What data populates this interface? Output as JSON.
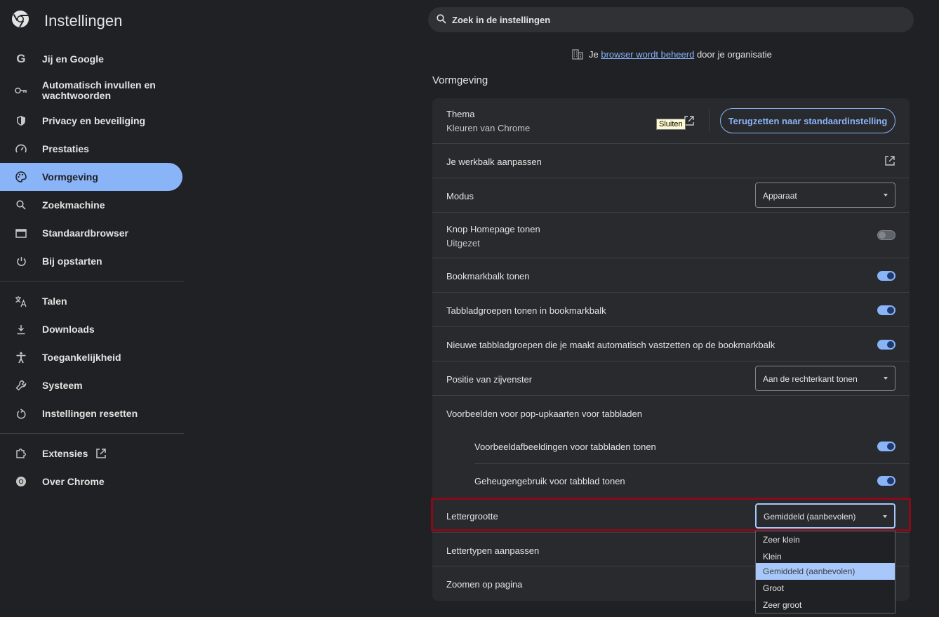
{
  "app": {
    "title": "Instellingen"
  },
  "sidebar": {
    "items": [
      {
        "label": "Jij en Google",
        "icon": "google-icon"
      },
      {
        "label": "Automatisch invullen en wachtwoorden",
        "icon": "key-icon"
      },
      {
        "label": "Privacy en beveiliging",
        "icon": "shield-icon"
      },
      {
        "label": "Prestaties",
        "icon": "speedometer-icon"
      },
      {
        "label": "Vormgeving",
        "icon": "palette-icon",
        "active": true
      },
      {
        "label": "Zoekmachine",
        "icon": "search-icon"
      },
      {
        "label": "Standaardbrowser",
        "icon": "browser-window-icon"
      },
      {
        "label": "Bij opstarten",
        "icon": "power-icon"
      },
      {
        "label": "Talen",
        "icon": "translate-icon"
      },
      {
        "label": "Downloads",
        "icon": "download-icon"
      },
      {
        "label": "Toegankelijkheid",
        "icon": "accessibility-icon"
      },
      {
        "label": "Systeem",
        "icon": "wrench-icon"
      },
      {
        "label": "Instellingen resetten",
        "icon": "reset-icon"
      },
      {
        "label": "Extensies",
        "icon": "puzzle-icon"
      },
      {
        "label": "Over Chrome",
        "icon": "chrome-icon"
      }
    ]
  },
  "search": {
    "placeholder": "Zoek in de instellingen"
  },
  "managed": {
    "prefix": "Je",
    "link": "browser wordt beheerd",
    "suffix": "door je organisatie"
  },
  "section": {
    "title": "Vormgeving"
  },
  "rows": {
    "theme_label": "Thema",
    "theme_sub": "Kleuren van Chrome",
    "theme_reset": "Terugzetten naar standaardinstelling",
    "toolbar": "Je werkbalk aanpassen",
    "mode_label": "Modus",
    "mode_value": "Apparaat",
    "home_label": "Knop Homepage tonen",
    "home_sub": "Uitgezet",
    "bookmarks": "Bookmarkbalk tonen",
    "tabgroups": "Tabbladgroepen tonen in bookmarkbalk",
    "pin_groups": "Nieuwe tabbladgroepen die je maakt automatisch vastzetten op de bookmarkbalk",
    "sidepanel_label": "Positie van zijvenster",
    "sidepanel_value": "Aan de rechterkant tonen",
    "hover_title": "Voorbeelden voor pop-upkaarten voor tabbladen",
    "hover_images": "Voorbeeldafbeeldingen voor tabbladen tonen",
    "hover_memory": "Geheugengebruik voor tabblad tonen",
    "fontsize_label": "Lettergrootte",
    "fontsize_value": "Gemiddeld (aanbevolen)",
    "fonts": "Lettertypen aanpassen",
    "zoom": "Zoomen op pagina"
  },
  "toggles": {
    "home": false,
    "bookmarks": true,
    "tabgroups": true,
    "pin_groups": true,
    "hover_images": true,
    "hover_memory": true
  },
  "tooltip": "Sluiten",
  "dropdown": {
    "options": [
      "Zeer klein",
      "Klein",
      "Gemiddeld (aanbevolen)",
      "Groot",
      "Zeer groot"
    ],
    "selected": "Gemiddeld (aanbevolen)"
  },
  "colors": {
    "accent": "#8ab4f8",
    "background": "#202124",
    "card": "#292a2d",
    "highlight_border": "#8b0a1a"
  }
}
